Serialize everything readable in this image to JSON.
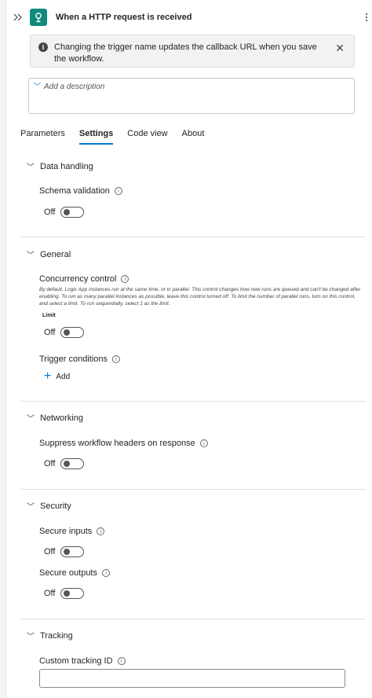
{
  "header": {
    "title": "When a HTTP request is received",
    "collapse_icon": "double-chevron-right-icon",
    "trigger_icon": "http-request-icon",
    "more_icon": "more-vertical-icon"
  },
  "info_bar": {
    "text": "Changing the trigger name updates the callback URL when you save the workflow.",
    "icon": "info-icon",
    "close_icon": "close-icon"
  },
  "description": {
    "placeholder": "Add a description"
  },
  "tabs": [
    {
      "label": "Parameters",
      "active": false
    },
    {
      "label": "Settings",
      "active": true
    },
    {
      "label": "Code view",
      "active": false
    },
    {
      "label": "About",
      "active": false
    }
  ],
  "sections": {
    "data_handling": {
      "title": "Data handling",
      "schema_validation": {
        "label": "Schema validation",
        "state": "Off"
      }
    },
    "general": {
      "title": "General",
      "concurrency_control": {
        "label": "Concurrency control",
        "help": "By default, Logic App instances run at the same time, or in parallel. This control changes how new runs are queued and can't be changed after enabling. To run as many parallel instances as possible, leave this control turned off. To limit the number of parallel runs, turn on this control, and select a limit. To run sequentially, select 1 as the limit.",
        "limit_label": "Limit",
        "state": "Off"
      },
      "trigger_conditions": {
        "label": "Trigger conditions",
        "add_label": "Add"
      }
    },
    "networking": {
      "title": "Networking",
      "suppress_headers": {
        "label": "Suppress workflow headers on response",
        "state": "Off"
      }
    },
    "security": {
      "title": "Security",
      "secure_inputs": {
        "label": "Secure inputs",
        "state": "Off"
      },
      "secure_outputs": {
        "label": "Secure outputs",
        "state": "Off"
      }
    },
    "tracking": {
      "title": "Tracking",
      "custom_tracking_id": {
        "label": "Custom tracking ID",
        "value": ""
      }
    }
  },
  "colors": {
    "accent": "#0078d4",
    "trigger_icon_bg": "#0f8a7e",
    "info_bar_bg": "#f2f2f2"
  }
}
